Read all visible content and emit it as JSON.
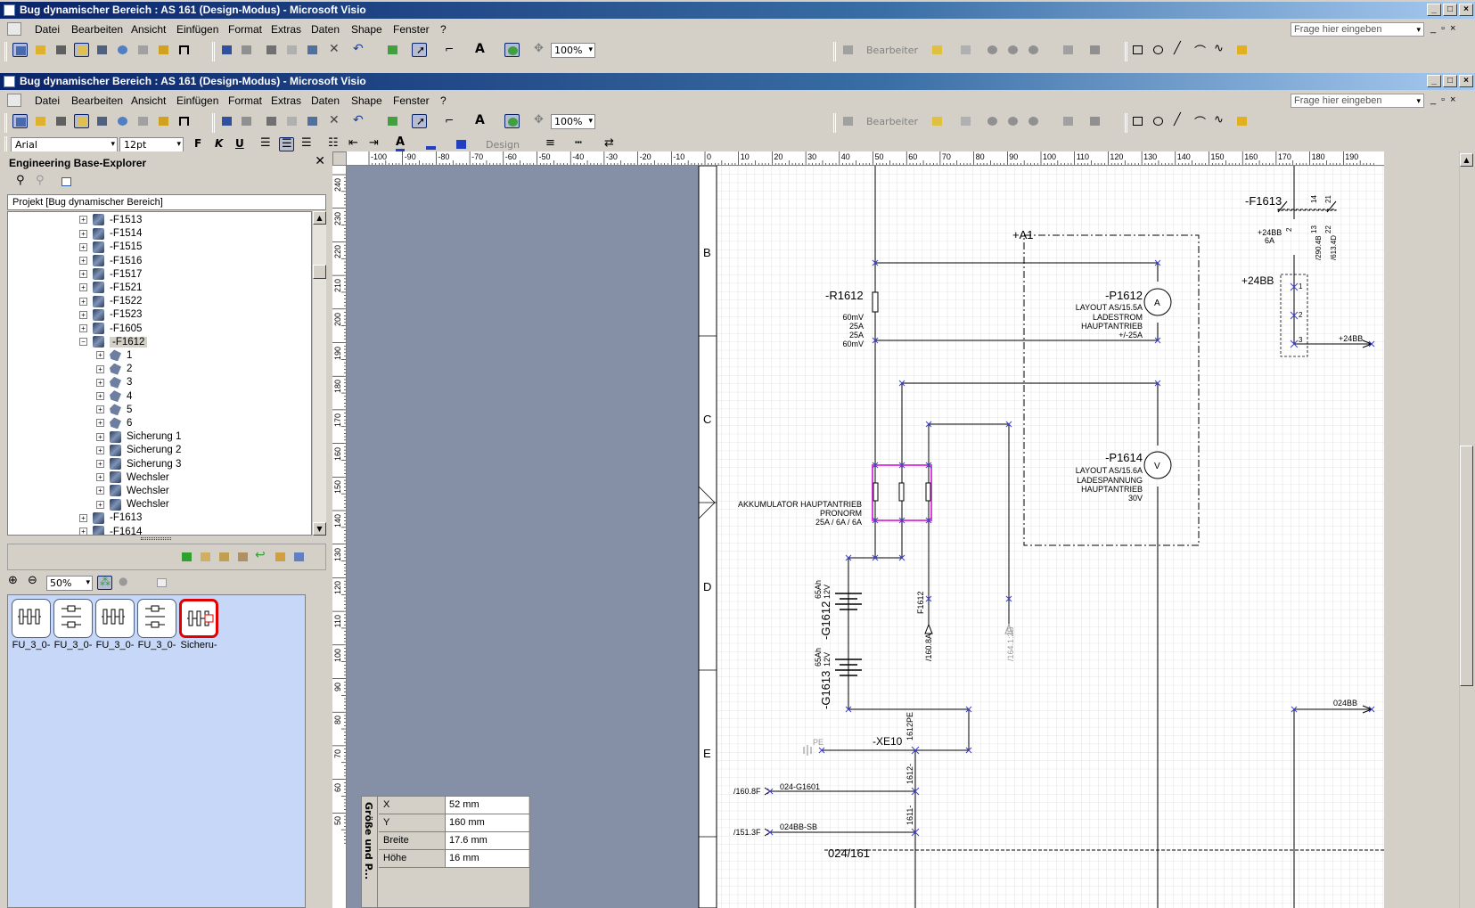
{
  "outer_window": {
    "title": "Bug dynamischer Bereich : AS 161 (Design-Modus) - Microsoft Visio"
  },
  "inner_window": {
    "title": "Bug dynamischer Bereich : AS 161 (Design-Modus) - Microsoft Visio"
  },
  "menu": {
    "items": [
      "Datei",
      "Bearbeiten",
      "Ansicht",
      "Einfügen",
      "Format",
      "Extras",
      "Daten",
      "Shape",
      "Fenster",
      "?"
    ],
    "ask_placeholder": "Frage hier eingeben"
  },
  "toolbar": {
    "zoom": "100%",
    "editor_label": "Bearbeiter",
    "design_label": "Design"
  },
  "format_toolbar": {
    "font": "Arial",
    "size": "12pt",
    "bold": "F",
    "italic": "K",
    "underline": "U"
  },
  "explorer": {
    "title": "Engineering Base-Explorer",
    "project": "Projekt [Bug dynamischer Bereich]",
    "tree": [
      {
        "label": "-F1513",
        "level": 0
      },
      {
        "label": "-F1514",
        "level": 0
      },
      {
        "label": "-F1515",
        "level": 0
      },
      {
        "label": "-F1516",
        "level": 0
      },
      {
        "label": "-F1517",
        "level": 0
      },
      {
        "label": "-F1521",
        "level": 0
      },
      {
        "label": "-F1522",
        "level": 0
      },
      {
        "label": "-F1523",
        "level": 0
      },
      {
        "label": "-F1605",
        "level": 0
      },
      {
        "label": "-F1612",
        "level": 0,
        "expanded": true,
        "selected": true
      },
      {
        "label": "1",
        "level": 1
      },
      {
        "label": "2",
        "level": 1
      },
      {
        "label": "3",
        "level": 1
      },
      {
        "label": "4",
        "level": 1
      },
      {
        "label": "5",
        "level": 1
      },
      {
        "label": "6",
        "level": 1
      },
      {
        "label": "Sicherung 1",
        "level": 1
      },
      {
        "label": "Sicherung 2",
        "level": 1
      },
      {
        "label": "Sicherung 3",
        "level": 1
      },
      {
        "label": "Wechsler",
        "level": 1
      },
      {
        "label": "Wechsler",
        "level": 1
      },
      {
        "label": "Wechsler",
        "level": 1
      },
      {
        "label": "-F1613",
        "level": 0
      },
      {
        "label": "-F1614",
        "level": 0
      }
    ]
  },
  "stencil": {
    "zoom": "50%",
    "shapes": [
      {
        "label": "FU_3_0-"
      },
      {
        "label": "FU_3_0-"
      },
      {
        "label": "FU_3_0-"
      },
      {
        "label": "FU_3_0-"
      },
      {
        "label": "Sicheru-",
        "selected": true
      }
    ]
  },
  "ruler": {
    "h_ticks": [
      "-100",
      "-90",
      "-80",
      "-70",
      "-60",
      "-50",
      "-40",
      "-30",
      "-20",
      "-10",
      "0",
      "10",
      "20",
      "30",
      "40",
      "50",
      "60",
      "70",
      "80",
      "90",
      "100",
      "110",
      "120",
      "130",
      "140",
      "150",
      "160",
      "170",
      "180",
      "190"
    ],
    "v_ticks": [
      "240",
      "230",
      "220",
      "210",
      "200",
      "190",
      "180",
      "170",
      "160",
      "150",
      "140",
      "130",
      "120",
      "110",
      "100",
      "90",
      "80",
      "70",
      "60",
      "50"
    ]
  },
  "size_window": {
    "title": "Größe und P...",
    "rows": [
      {
        "label": "X",
        "value": "52 mm"
      },
      {
        "label": "Y",
        "value": "160 mm"
      },
      {
        "label": "Breite",
        "value": "17.6 mm"
      },
      {
        "label": "Höhe",
        "value": "16 mm"
      }
    ]
  },
  "drawing": {
    "rows": [
      "B",
      "C",
      "D",
      "E"
    ],
    "labels": {
      "f1613": "-F1613",
      "a1": "+A1",
      "r1612": "-R1612",
      "r1612_specs": [
        "60mV",
        "25A",
        "25A",
        "60mV"
      ],
      "p1612": "-P1612",
      "p1612_desc": [
        "LAYOUT AS/15.5A",
        "LADESTROM",
        "HAUPTANTRIEB",
        "+/-25A"
      ],
      "p1614": "-P1614",
      "p1614_desc": [
        "LAYOUT AS/15.6A",
        "LADESPANNUNG",
        "HAUPTANTRIEB",
        "30V"
      ],
      "akku": [
        "AKKUMULATOR HAUPTANTRIEB",
        "PRONORM",
        "25A / 6A / 6A"
      ],
      "g1612": "-G1612",
      "g1613": "-G1613",
      "bat_spec1": [
        "65Ah",
        "12V"
      ],
      "bat_spec2": [
        "65Ah",
        "12V"
      ],
      "bb24_top": "+24BB",
      "bb24_6a": [
        "+24BB",
        "6A"
      ],
      "bb24_arrow": "+24BB",
      "bb24_right": "024BB",
      "f1612": "F1612",
      "ref_1608a": "/160.8A",
      "ref_1641": "/164.1:2B",
      "xe10": "-XE10",
      "pe": "PE",
      "lbl_1612pe": "1612PE",
      "ref_1608f": "/160.8F",
      "ref_1513f": "/151.3F",
      "g1601": "024-G1601",
      "bb_sb": "024BB-SB",
      "sheet": "024/161",
      "lbl_1612": "1612-",
      "lbl_1611": "1611-",
      "f1613_pins": [
        "14",
        "21",
        "13",
        "22"
      ],
      "f1613_refs": [
        "/290.4B",
        "/613.4D"
      ],
      "pin_nums": [
        "1",
        "2",
        "3"
      ],
      "f1613_pin2": "2"
    }
  },
  "colors": {
    "title_start": "#0a246a",
    "title_end": "#a6caf0",
    "stencil_bg": "#c6d7f7",
    "drawing_bg": "#8590a6",
    "selection": "#e040e0",
    "grid": "#c8c8c8"
  }
}
